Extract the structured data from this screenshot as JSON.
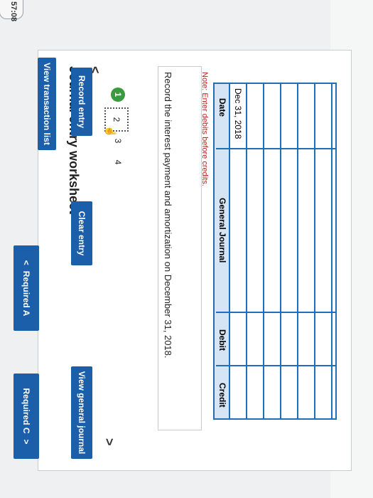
{
  "header": {
    "view_transactions_label": "View transaction list",
    "timer_text": "57:08",
    "edge_glyph": "5"
  },
  "worksheet": {
    "title": "Journal entry worksheet",
    "prev_arrow": "<",
    "next_arrow": ">",
    "steps": [
      "1",
      "2",
      "3",
      "4"
    ],
    "active_step": "1",
    "instruction": "Record the interest payment and amortization on December 31, 2018.",
    "note": "Note: Enter debits before credits."
  },
  "journal": {
    "columns": [
      "Date",
      "General Journal",
      "Debit",
      "Credit"
    ],
    "rows": [
      {
        "date": "Dec 31, 2018",
        "account": "",
        "debit": "",
        "credit": ""
      },
      {
        "date": "",
        "account": "",
        "debit": "",
        "credit": ""
      },
      {
        "date": "",
        "account": "",
        "debit": "",
        "credit": ""
      },
      {
        "date": "",
        "account": "",
        "debit": "",
        "credit": ""
      },
      {
        "date": "",
        "account": "",
        "debit": "",
        "credit": ""
      },
      {
        "date": "",
        "account": "",
        "debit": "",
        "credit": ""
      }
    ]
  },
  "buttons": {
    "record_entry": "Record entry",
    "clear_entry": "Clear entry",
    "view_general_journal": "View general journal"
  },
  "footer": {
    "prev_label": "Required A",
    "prev_icon": "<",
    "next_label": "Required C",
    "next_icon": ">"
  },
  "colors": {
    "primary": "#1b5faa",
    "grid": "#1f6fb8",
    "header_fill": "#d6e5f6",
    "active_step": "#3a9a3f",
    "note_red": "#b3261e"
  }
}
